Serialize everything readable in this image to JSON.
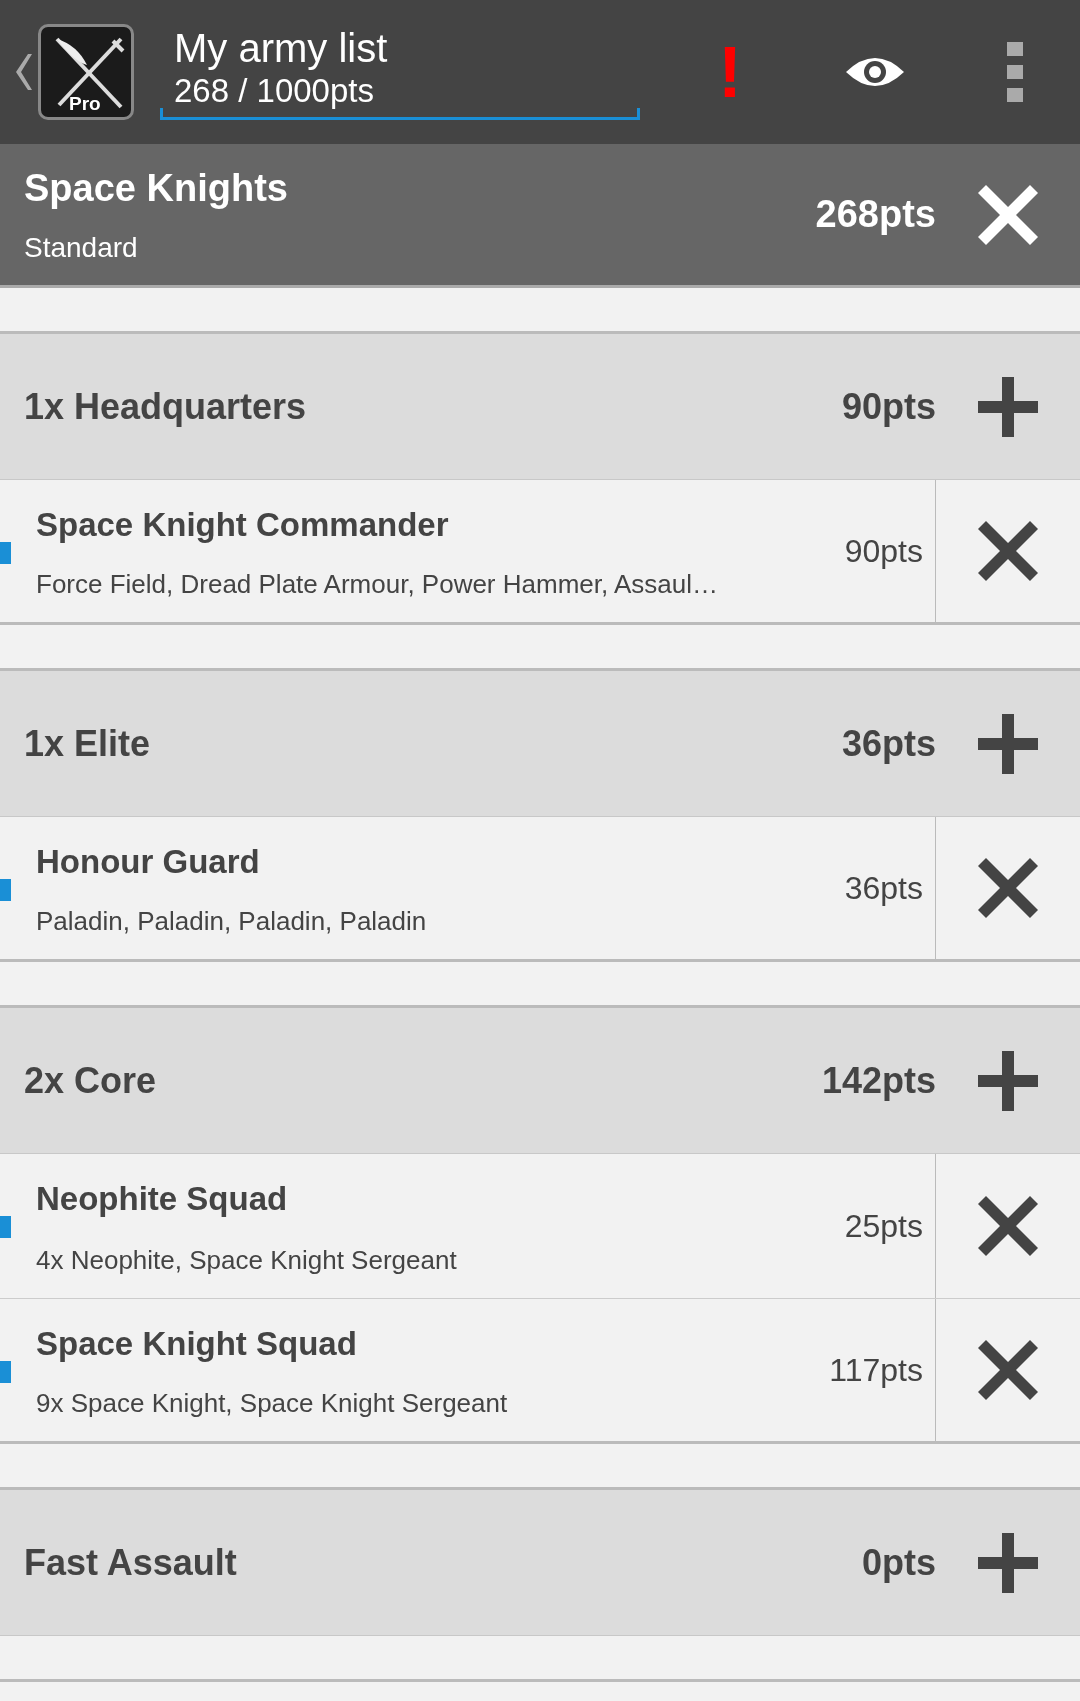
{
  "app_bar": {
    "logo_badge": "Pro",
    "title": "My army list",
    "subtitle": "268 / 1000pts",
    "warning": "!"
  },
  "army": {
    "name": "Space Knights",
    "detail": "Standard",
    "points": "268pts"
  },
  "sections": [
    {
      "title": "1x Headquarters",
      "points": "90pts",
      "entries": [
        {
          "name": "Space Knight Commander",
          "detail": "Force Field, Dread Plate Armour, Power Hammer, Assaul…",
          "points": "90pts"
        }
      ]
    },
    {
      "title": "1x Elite",
      "points": "36pts",
      "entries": [
        {
          "name": "Honour Guard",
          "detail": "Paladin, Paladin, Paladin, Paladin",
          "points": "36pts"
        }
      ]
    },
    {
      "title": "2x Core",
      "points": "142pts",
      "entries": [
        {
          "name": "Neophite Squad",
          "detail": "4x Neophite, Space Knight Sergeant",
          "points": "25pts"
        },
        {
          "name": "Space Knight Squad",
          "detail": "9x Space Knight, Space Knight Sergeant",
          "points": "117pts"
        }
      ]
    },
    {
      "title": "Fast Assault",
      "points": "0pts"
    }
  ]
}
